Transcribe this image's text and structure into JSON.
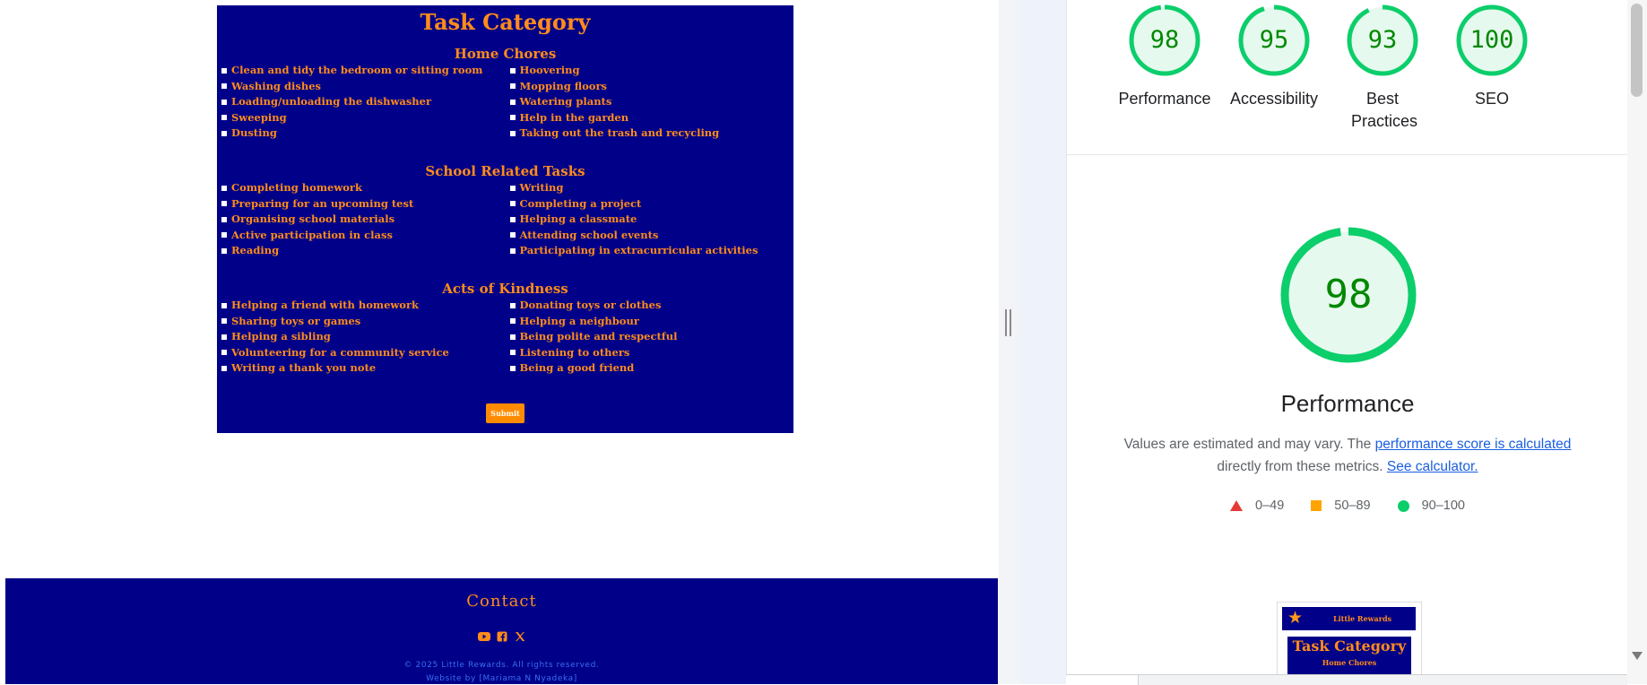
{
  "task_page": {
    "title": "Task Category",
    "sections": [
      {
        "heading": "Home Chores",
        "left": [
          "Clean and tidy the bedroom or sitting room",
          "Washing dishes",
          "Loading/unloading the dishwasher",
          "Sweeping",
          "Dusting"
        ],
        "right": [
          "Hoovering",
          "Mopping floors",
          "Watering plants",
          "Help in the garden",
          "Taking out the trash and recycling"
        ]
      },
      {
        "heading": "School Related Tasks",
        "left": [
          "Completing homework",
          "Preparing for an upcoming test",
          "Organising school materials",
          "Active participation in class",
          "Reading"
        ],
        "right": [
          "Writing",
          "Completing a project",
          "Helping a classmate",
          "Attending school events",
          "Participating in extracurricular activities"
        ]
      },
      {
        "heading": "Acts of Kindness",
        "left": [
          "Helping a friend with homework",
          "Sharing toys or games",
          "Helping a sibling",
          "Volunteering for a community service",
          "Writing a thank you note"
        ],
        "right": [
          "Donating toys or clothes",
          "Helping a neighbour",
          "Being polite and respectful",
          "Listening to others",
          "Being a good friend"
        ]
      }
    ],
    "submit_label": "Submit"
  },
  "footer": {
    "heading": "Contact",
    "socials": [
      "youtube-icon",
      "facebook-icon",
      "x-icon"
    ],
    "copyright": "© 2025 Little Rewards. All rights reserved.",
    "credit": "Website by [Mariama N Nyadeka]"
  },
  "lighthouse": {
    "gauges": [
      {
        "score": "98",
        "label": "Performance"
      },
      {
        "score": "95",
        "label": "Accessibility"
      },
      {
        "score": "93",
        "label": "Best Practices"
      },
      {
        "score": "100",
        "label": "SEO"
      }
    ],
    "main_score": "98",
    "main_label": "Performance",
    "desc_prefix": "Values are estimated and may vary. The",
    "desc_link1": "performance score is calculated",
    "desc_mid": "directly from these metrics.",
    "desc_link2": "See calculator.",
    "legend": [
      "0–49",
      "50–89",
      "90–100"
    ],
    "colors": {
      "pass": "#0cce6b",
      "average": "#ffa400",
      "fail": "#e53935",
      "score_text": "#008800"
    },
    "thumbnail": {
      "brand": "Little Rewards",
      "title": "Task Category",
      "subtitle": "Home Chores"
    }
  }
}
